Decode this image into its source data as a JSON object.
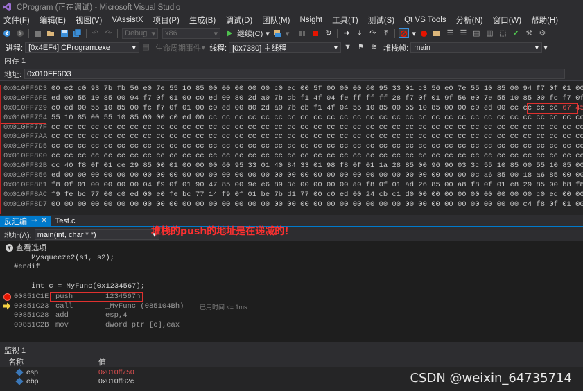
{
  "window": {
    "title": "CProgram (正在调试) - Microsoft Visual Studio"
  },
  "menu": [
    "文件(F)",
    "编辑(E)",
    "视图(V)",
    "VAssistX",
    "项目(P)",
    "生成(B)",
    "调试(D)",
    "团队(M)",
    "Nsight",
    "工具(T)",
    "测试(S)",
    "Qt VS Tools",
    "分析(N)",
    "窗口(W)",
    "帮助(H)"
  ],
  "toolbar1": {
    "config": "Debug",
    "platform": "x86",
    "continue_label": "继续(C)"
  },
  "toolbar2": {
    "process_label": "进程:",
    "process_value": "[0x4EF4] CProgram.exe",
    "lifecycle_label": "生命周期事件",
    "thread_label": "线程:",
    "thread_value": "[0x7380] 主线程",
    "stackframe_label": "堆栈帧:",
    "stackframe_value": "main"
  },
  "memory": {
    "title": "内存 1",
    "address_label": "地址:",
    "address_value": "0x010FF6D3",
    "rows": [
      {
        "addr": "0x010FF6D3",
        "bytes": "00 e2 c0 93 7b fb 56 e0 7e 55 10 85 00 00 00 00 00 c0 ed 00 5f 00 00 00 60 95 33 01 c3 56 e0 7e 55 10 85 00 94 f7 0f 01 00 c0",
        "tail": ""
      },
      {
        "addr": "0x010FF6FE",
        "bytes": "ed 00 55 10 85 00 94 f7 0f 01 00 c0 ed 00 80 2d a0 7b cb f1 4f 04 fe ff ff ff 28 f7 0f 01 9f 56 e0 7e 55 10 85 00 fc f7 0f 01 00",
        "tail": ""
      },
      {
        "addr": "0x010FF729",
        "bytes": "c0 ed 00 55 10 85 00 fc f7 0f 01 00 c0 ed 00 80 2d a0 7b cb f1 4f 04 55 10 85 00 55 10 85 00 00 c0 ed 00 cc cc cc cc ",
        "tail": "67 45 23 01"
      },
      {
        "addr": "0x010FF754",
        "bytes": "55 10 85 00 55 10 85 00 00 c0 ed 00 cc cc cc cc cc cc cc cc cc cc cc cc cc cc cc cc cc cc cc cc cc cc cc cc cc cc cc cc cc cc",
        "tail": ""
      },
      {
        "addr": "0x010FF77F",
        "bytes": "cc cc cc cc cc cc cc cc cc cc cc cc cc cc cc cc cc cc cc cc cc cc cc cc cc cc cc cc cc cc cc cc cc cc cc cc cc cc cc cc cc cc",
        "tail": ""
      },
      {
        "addr": "0x010FF7AA",
        "bytes": "cc cc cc cc cc cc cc cc cc cc cc cc cc cc cc cc cc cc cc cc cc cc cc cc cc cc cc cc cc cc cc cc cc cc cc cc cc cc cc cc cc cc",
        "tail": ""
      },
      {
        "addr": "0x010FF7D5",
        "bytes": "cc cc cc cc cc cc cc cc cc cc cc cc cc cc cc cc cc cc cc cc cc cc cc cc cc cc cc cc cc cc cc cc cc cc cc cc cc cc cc cc cc cc",
        "tail": ""
      },
      {
        "addr": "0x010FF800",
        "bytes": "cc cc cc cc cc cc cc cc cc cc cc cc cc cc cc cc cc cc cc cc cc cc cc cc cc cc cc cc cc cc cc cc cc cc cc cc cc cc cc cc cc cc",
        "tail": ""
      },
      {
        "addr": "0x010FF82B",
        "bytes": "cc 40 f8 0f 01 ce 29 85 00 01 00 00 00 60 95 33 01 40 84 33 01 98 f8 0f 01 1a 28 85 00 96 90 03 3c 55 10 85 00 55 10 85 00 00 c0",
        "tail": ""
      },
      {
        "addr": "0x010FF856",
        "bytes": "ed 00 00 00 00 00 00 00 00 00 00 00 00 00 00 00 00 00 00 00 00 00 00 00 00 00 00 00 00 00 00 00 0c a6 85 00 18 a6 85 00 00 00 48",
        "tail": ""
      },
      {
        "addr": "0x010FF881",
        "bytes": "f8 0f 01 00 00 00 00 04 f9 0f 01 90 47 85 00 9e e6 89 3d 00 00 00 00 a0 f8 0f 01 ad 26 85 00 a8 f8 0f 01 e8 29 85 00 b8 f8 0f 01",
        "tail": ""
      },
      {
        "addr": "0x010FF8AC",
        "bytes": "f9 fe bc 77 00 c0 ed 00 e0 fe bc 77 14 f9 0f 01 be 7b d1 77 00 c0 ed 00 24 cb c1 d0 00 00 00 00 00 00 00 00 00 c0 ed 00 00 00 00",
        "tail": ""
      },
      {
        "addr": "0x010FF8D7",
        "bytes": "00 00 00 00 00 00 00 00 00 00 00 00 00 00 00 00 00 00 00 00 00 00 00 00 00 00 00 00 00 00 00 00 00 00 00 00 c4 f8 0f 01 00 00",
        "tail": ""
      }
    ]
  },
  "disasm_tabs": [
    {
      "label": "反汇编",
      "active": true
    },
    {
      "label": "Test.c",
      "active": false
    }
  ],
  "disasm": {
    "address_label": "地址(A):",
    "address_value": "main(int, char * *)",
    "view_options": "查看选项",
    "annotation": "堆栈的push的地址是在递减的！",
    "source_lines": [
      "    Mysqueeze2(s1, s2);",
      "#endif",
      "",
      "    int c = MyFunc(0x1234567);"
    ],
    "asm_lines": [
      {
        "addr": "00851C1E",
        "mnem": "push",
        "ops": "1234567h",
        "hint": ""
      },
      {
        "addr": "00851C23",
        "mnem": "call",
        "ops": "_MyFunc (085104Bh)",
        "hint": "已用时间 <= 1ms"
      },
      {
        "addr": "00851C28",
        "mnem": "add",
        "ops": "esp,4",
        "hint": ""
      },
      {
        "addr": "00851C2B",
        "mnem": "mov",
        "ops": "dword ptr [c],eax",
        "hint": ""
      }
    ]
  },
  "watch": {
    "title": "监视 1",
    "col_name": "名称",
    "col_value": "值",
    "rows": [
      {
        "name": "esp",
        "value": "0x010ff750",
        "changed": true
      },
      {
        "name": "ebp",
        "value": "0x010ff82c",
        "changed": false
      }
    ]
  },
  "watermark": "CSDN @weixin_64735714",
  "colors": {
    "accent": "#007acc",
    "highlight_red": "#e0312f",
    "changed_value": "#e05050"
  }
}
